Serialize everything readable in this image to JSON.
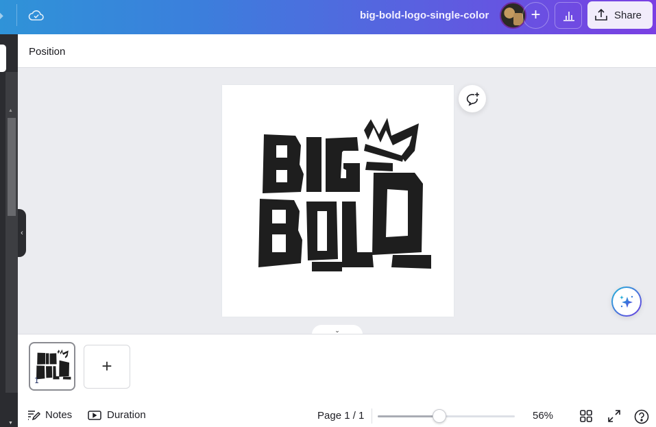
{
  "topbar": {
    "document_title": "big-bold-logo-single-color",
    "add_collaborator_label": "+",
    "share_label": "Share",
    "icons": {
      "save_status": "cloud-check-icon",
      "insights": "bar-chart-icon",
      "share": "upload-icon"
    },
    "gradient_colors": [
      "#2f93d8",
      "#5b5fe0",
      "#7a3fe3"
    ]
  },
  "context_toolbar": {
    "position_label": "Position"
  },
  "canvas": {
    "logo_text_line1": "BIG",
    "logo_text_line2": "BOLD",
    "logo_color": "#1e1e1e",
    "comment_icon": "add-comment-icon",
    "magic_icon": "sparkle-icon",
    "hide_pages_icon": "chevron-down-icon"
  },
  "pages": {
    "thumbnails": [
      {
        "number": "1"
      }
    ],
    "add_page_label": "+"
  },
  "footer": {
    "notes_label": "Notes",
    "duration_label": "Duration",
    "page_indicator": "Page 1 / 1",
    "zoom_percent": "56%",
    "zoom_slider_fraction": 0.45,
    "icons": {
      "notes": "notes-pencil-icon",
      "duration": "play-box-icon",
      "grid": "grid-view-icon",
      "fullscreen": "expand-icon",
      "help": "help-circle-icon"
    }
  },
  "left_rail": {
    "collapse_icon": "chevron-left-icon"
  }
}
